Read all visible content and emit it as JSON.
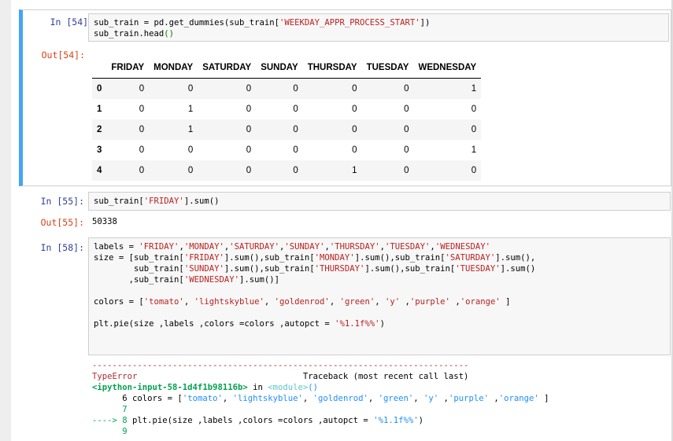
{
  "top_partial_text": "_ _ _ _ _ _ _ _ _ _ _ _ _ _ _ _ _ _ _",
  "cells": {
    "c54": {
      "in_prompt": "In [54]:",
      "out_prompt": "Out[54]:",
      "code_line1_a": "sub_train = pd.get_dummies(sub_train[",
      "code_line1_str": "'WEEKDAY_APPR_PROCESS_START'",
      "code_line1_b": "])",
      "code_line2_a": "sub_train.head",
      "code_line2_paren": "()",
      "table": {
        "columns": [
          "FRIDAY",
          "MONDAY",
          "SATURDAY",
          "SUNDAY",
          "THURSDAY",
          "TUESDAY",
          "WEDNESDAY"
        ],
        "rows": [
          {
            "index": "0",
            "values": [
              "0",
              "0",
              "0",
              "0",
              "0",
              "0",
              "1"
            ]
          },
          {
            "index": "1",
            "values": [
              "0",
              "1",
              "0",
              "0",
              "0",
              "0",
              "0"
            ]
          },
          {
            "index": "2",
            "values": [
              "0",
              "1",
              "0",
              "0",
              "0",
              "0",
              "0"
            ]
          },
          {
            "index": "3",
            "values": [
              "0",
              "0",
              "0",
              "0",
              "0",
              "0",
              "1"
            ]
          },
          {
            "index": "4",
            "values": [
              "0",
              "0",
              "0",
              "0",
              "1",
              "0",
              "0"
            ]
          }
        ]
      }
    },
    "c55": {
      "in_prompt": "In [55]:",
      "out_prompt": "Out[55]:",
      "code_a": "sub_train[",
      "code_str": "'FRIDAY'",
      "code_b": "].sum()",
      "output": "50338"
    },
    "c58": {
      "in_prompt": "In [58]:",
      "code_lines": [
        [
          {
            "t": "labels = "
          },
          {
            "t": "'FRIDAY'",
            "s": 1
          },
          {
            "t": ","
          },
          {
            "t": "'MONDAY'",
            "s": 1
          },
          {
            "t": ","
          },
          {
            "t": "'SATURDAY'",
            "s": 1
          },
          {
            "t": ","
          },
          {
            "t": "'SUNDAY'",
            "s": 1
          },
          {
            "t": ","
          },
          {
            "t": "'THURSDAY'",
            "s": 1
          },
          {
            "t": ","
          },
          {
            "t": "'TUESDAY'",
            "s": 1
          },
          {
            "t": ","
          },
          {
            "t": "'WEDNESDAY'",
            "s": 1
          }
        ],
        [
          {
            "t": "size = [sub_train["
          },
          {
            "t": "'FRIDAY'",
            "s": 1
          },
          {
            "t": "].sum(),sub_train["
          },
          {
            "t": "'MONDAY'",
            "s": 1
          },
          {
            "t": "].sum(),sub_train["
          },
          {
            "t": "'SATURDAY'",
            "s": 1
          },
          {
            "t": "].sum(),"
          }
        ],
        [
          {
            "t": "        sub_train["
          },
          {
            "t": "'SUNDAY'",
            "s": 1
          },
          {
            "t": "].sum(),sub_train["
          },
          {
            "t": "'THURSDAY'",
            "s": 1
          },
          {
            "t": "].sum(),sub_train["
          },
          {
            "t": "'TUESDAY'",
            "s": 1
          },
          {
            "t": "].sum()"
          }
        ],
        [
          {
            "t": "       ,sub_train["
          },
          {
            "t": "'WEDNESDAY'",
            "s": 1
          },
          {
            "t": "].sum()]"
          }
        ],
        [
          {
            "t": ""
          }
        ],
        [
          {
            "t": "colors = ["
          },
          {
            "t": "'tomato'",
            "s": 1
          },
          {
            "t": ", "
          },
          {
            "t": "'lightskyblue'",
            "s": 1
          },
          {
            "t": ", "
          },
          {
            "t": "'goldenrod'",
            "s": 1
          },
          {
            "t": ", "
          },
          {
            "t": "'green'",
            "s": 1
          },
          {
            "t": ", "
          },
          {
            "t": "'y'",
            "s": 1
          },
          {
            "t": " ,"
          },
          {
            "t": "'purple'",
            "s": 1
          },
          {
            "t": " ,"
          },
          {
            "t": "'orange'",
            "s": 1
          },
          {
            "t": " ]"
          }
        ],
        [
          {
            "t": ""
          }
        ],
        [
          {
            "t": "plt.pie(size ,labels ,colors =colors ,autopct = "
          },
          {
            "t": "'%1.1f%%'",
            "s": 1
          },
          {
            "t": ")"
          }
        ]
      ],
      "traceback": [
        [
          {
            "t": "---------------------------------------------------------------------------",
            "c": "red"
          }
        ],
        [
          {
            "t": "TypeError",
            "c": "red"
          },
          {
            "t": "                                 Traceback (most recent call last)"
          }
        ],
        [
          {
            "t": "<ipython-input-58-1d4f1b98116b>",
            "c": "gline"
          },
          {
            "t": " in "
          },
          {
            "t": "<module>",
            "c": "cyan"
          },
          {
            "t": "()",
            "c": "blue"
          }
        ],
        [
          {
            "t": "      6 "
          },
          {
            "t": "colors = [",
            "c": ""
          },
          {
            "t": "'tomato'",
            "c": "blue"
          },
          {
            "t": ", "
          },
          {
            "t": "'lightskyblue'",
            "c": "blue"
          },
          {
            "t": ", "
          },
          {
            "t": "'goldenrod'",
            "c": "blue"
          },
          {
            "t": ", "
          },
          {
            "t": "'green'",
            "c": "blue"
          },
          {
            "t": ", "
          },
          {
            "t": "'y'",
            "c": "blue"
          },
          {
            "t": " ,"
          },
          {
            "t": "'purple'",
            "c": "blue"
          },
          {
            "t": " ,"
          },
          {
            "t": "'orange'",
            "c": "blue"
          },
          {
            "t": " ]"
          }
        ],
        [
          {
            "t": "      7",
            "c": "green"
          }
        ],
        [
          {
            "t": "----> 8 ",
            "c": "green"
          },
          {
            "t": "plt.pie(size ,labels ,colors =colors ,autopct = "
          },
          {
            "t": "'%1.1f%%'",
            "c": "blue"
          },
          {
            "t": ")"
          }
        ],
        [
          {
            "t": "      9",
            "c": "green"
          }
        ]
      ]
    }
  }
}
